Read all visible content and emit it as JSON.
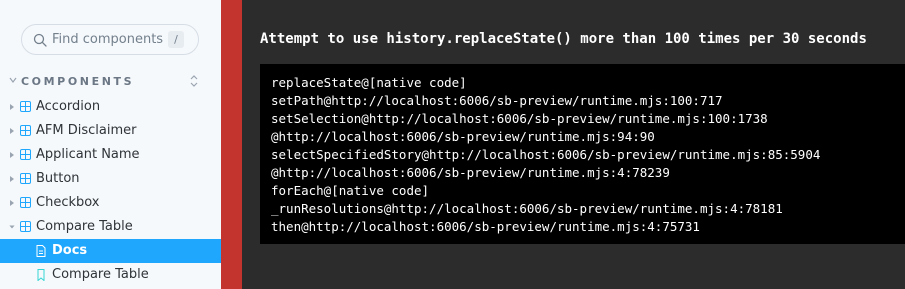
{
  "sidebar": {
    "search": {
      "placeholder": "Find components",
      "shortcut": "/"
    },
    "section_title": "COMPONENTS",
    "items": [
      {
        "label": "Accordion"
      },
      {
        "label": "AFM Disclaimer"
      },
      {
        "label": "Applicant Name"
      },
      {
        "label": "Button"
      },
      {
        "label": "Checkbox"
      },
      {
        "label": "Compare Table"
      },
      {
        "label": "Docs"
      },
      {
        "label": "Compare Table"
      }
    ]
  },
  "error": {
    "title": "Attempt to use history.replaceState() more than 100 times per 30 seconds",
    "stack": [
      "replaceState@[native code]",
      "setPath@http://localhost:6006/sb-preview/runtime.mjs:100:717",
      "setSelection@http://localhost:6006/sb-preview/runtime.mjs:100:1738",
      "@http://localhost:6006/sb-preview/runtime.mjs:94:90",
      "selectSpecifiedStory@http://localhost:6006/sb-preview/runtime.mjs:85:5904",
      "@http://localhost:6006/sb-preview/runtime.mjs:4:78239",
      "forEach@[native code]",
      "_runResolutions@http://localhost:6006/sb-preview/runtime.mjs:4:78181",
      "then@http://localhost:6006/sb-preview/runtime.mjs:4:75731"
    ]
  },
  "colors": {
    "accent": "#1ea7fd",
    "error_bar": "#c4342f",
    "component_icon": "#1ea7fd",
    "story_icon": "#37d5d3"
  }
}
